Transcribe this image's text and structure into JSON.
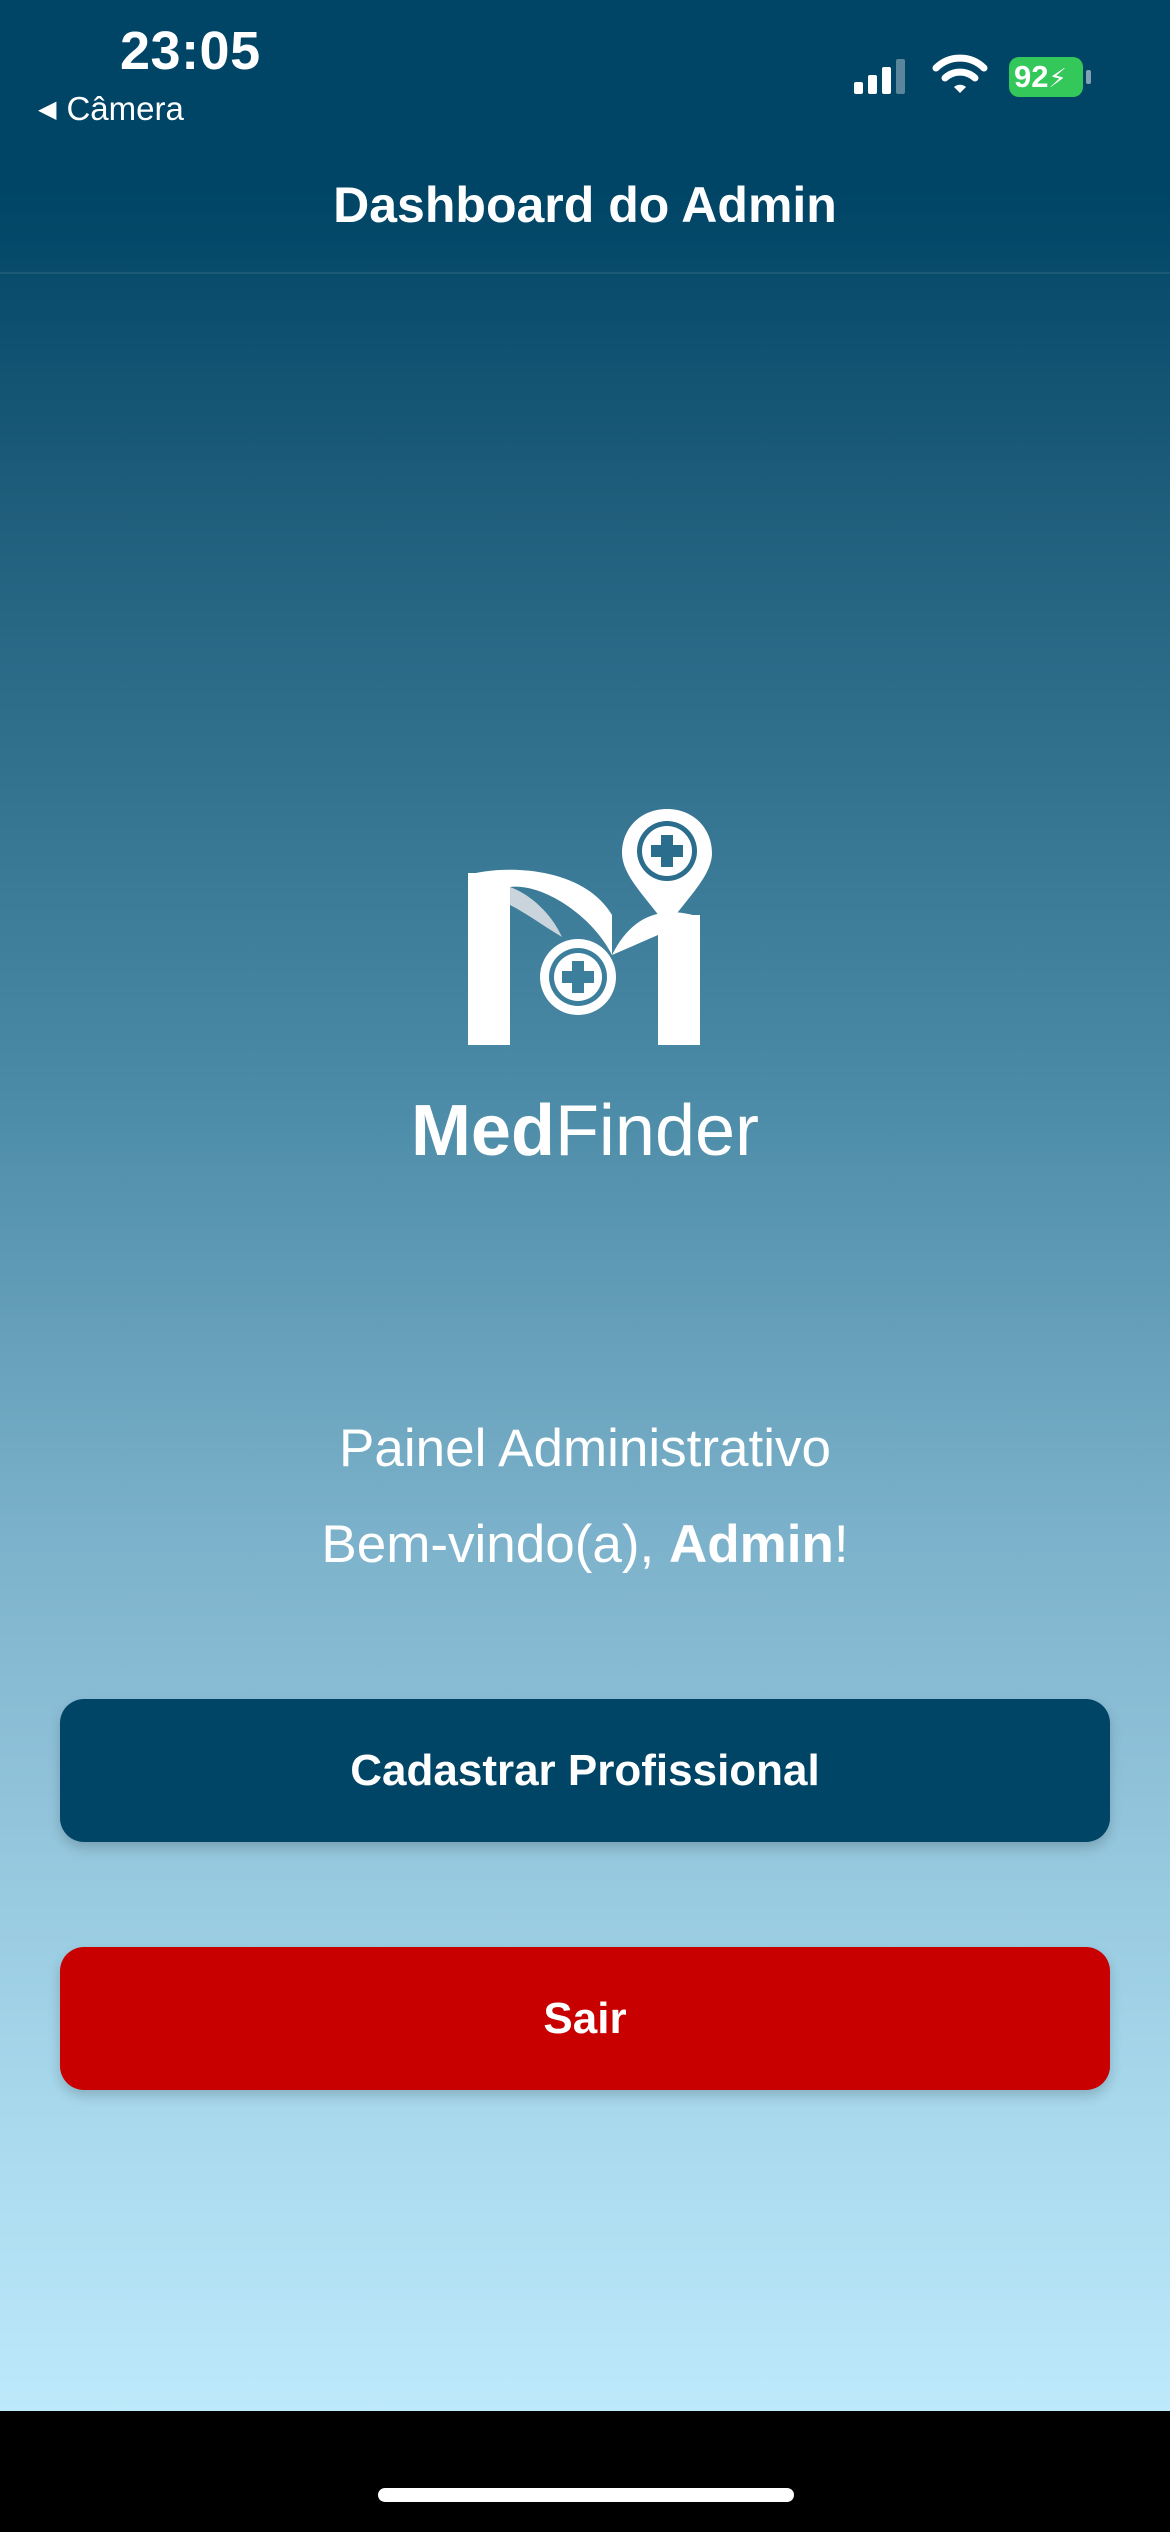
{
  "status_bar": {
    "time": "23:05",
    "back_app": "Câmera",
    "battery": "92",
    "icons": [
      "signal-icon",
      "wifi-icon",
      "battery-charging-icon"
    ],
    "battery_color": "#34c759"
  },
  "header": {
    "title": "Dashboard do Admin"
  },
  "logo": {
    "brand_bold": "Med",
    "brand_light": "Finder",
    "icon": "medfinder-logo-icon"
  },
  "main": {
    "subtitle": "Painel Administrativo",
    "welcome_prefix": "Bem-vindo(a), ",
    "welcome_name": "Admin",
    "welcome_suffix": "!"
  },
  "actions": {
    "register_label": "Cadastrar Profissional",
    "logout_label": "Sair"
  },
  "colors": {
    "primary": "#004566",
    "danger": "#c80000",
    "gradient_bottom": "#bde9fb"
  }
}
